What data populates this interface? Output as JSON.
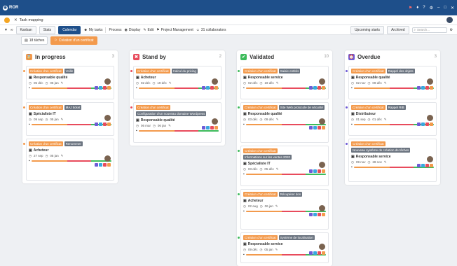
{
  "app": {
    "name": "ROR",
    "doc_title": "Task mapping"
  },
  "toolbar": {
    "kanban": "Kanban",
    "stats": "Stats",
    "calendar": "Calendar",
    "my_tasks": "My tasks",
    "process": "Process",
    "display": "Display",
    "edit": "Edit",
    "project": "Project Management",
    "collaborators": "31 collaborators",
    "upcoming": "Upcoming starts",
    "archived": "Archived",
    "search_placeholder": "Search..."
  },
  "filters": {
    "count": "18 tâches",
    "chip": "Création d'un certificat"
  },
  "columns": [
    {
      "title": "In progress",
      "count": "3",
      "color": "#f39a4c",
      "cards": [
        {
          "tag1": "Création d'un certificat",
          "tag2": "Veille",
          "role": "Responsable qualité",
          "d1": "05 déc",
          "d2": "05 jan"
        },
        {
          "tag1": "Création d'un certificat",
          "tag2": "MAJ ticket",
          "role": "Spécialiste IT",
          "d1": "09 sep",
          "d2": "05 jan"
        },
        {
          "tag1": "Création d'un certificat",
          "tag2": "Renommer",
          "role": "Acheteur",
          "d1": "27 sep",
          "d2": "05 jan"
        }
      ]
    },
    {
      "title": "Stand by",
      "count": "2",
      "color": "#e84b5c",
      "cards": [
        {
          "tag1": "Création d'un certificat",
          "tag2": "Calcul du pricing",
          "role": "Acheteur",
          "d1": "02 déc",
          "d2": "19 déc"
        },
        {
          "tag1": "Création d'un certificat",
          "tag2": "Configuration d'un nouveau domaine Wordpress",
          "role": "Responsable qualité",
          "d1": "06 mar",
          "d2": "06 jan"
        }
      ]
    },
    {
      "title": "Validated",
      "count": "10",
      "color": "#3dbb5b",
      "cards": [
        {
          "tag1": "Création d'un certificat",
          "tag2": "Saisie entités",
          "role": "Responsable service",
          "d1": "02 déc",
          "d2": "19 déc"
        },
        {
          "tag1": "Création d'un certificat",
          "tag2": "Site Web protocole de sécurité",
          "role": "Responsable qualité",
          "d1": "03 déc",
          "d2": "09 déc"
        },
        {
          "tag1": "Création d'un certificat",
          "tag2": "Informations sur les ventes 2020",
          "role": "Spécialiste IT",
          "d1": "03 déc",
          "d2": "05 déc"
        },
        {
          "tag1": "Création d'un certificat",
          "tag2": "Récupérer dos",
          "role": "Acheteur",
          "d1": "02 aug",
          "d2": "06 jan"
        },
        {
          "tag1": "Création d'un certificat",
          "tag2": "Système de localisation",
          "role": "Responsable service",
          "d1": "09 déc",
          "d2": "05 jan"
        }
      ]
    },
    {
      "title": "Overdue",
      "count": "3",
      "color": "#6e5bd6",
      "cards": [
        {
          "tag1": "Création d'un certificat",
          "tag2": "Rappel des objets",
          "role": "Responsable qualité",
          "d1": "02 nov",
          "d2": "09 déc"
        },
        {
          "tag1": "Création d'un certificat",
          "tag2": "Rappel RIB",
          "role": "Distributeur",
          "d1": "01 sep",
          "d2": "01 déc"
        },
        {
          "tag1": "Création d'un certificat",
          "tag2": "Nouveau système de création de tâches",
          "role": "Responsable service",
          "d1": "09 nov",
          "d2": "28 nov"
        }
      ]
    }
  ]
}
